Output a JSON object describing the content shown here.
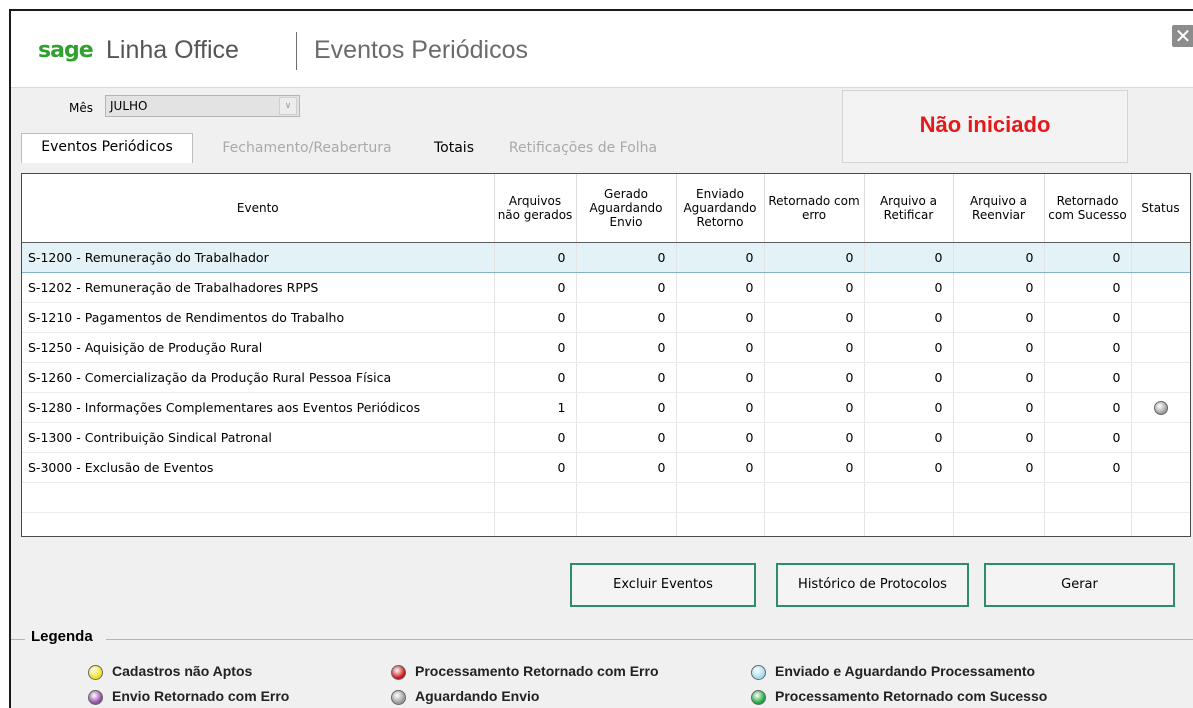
{
  "header": {
    "brand": "sage",
    "product": "Linha Office",
    "module": "Eventos Periódicos",
    "close_icon": "close-icon"
  },
  "filter": {
    "month_label": "Mês",
    "month_value": "JULHO"
  },
  "status": {
    "text": "Não iniciado",
    "color": "#e41a1a"
  },
  "tabs": [
    {
      "label": "Eventos Periódicos",
      "state": "active"
    },
    {
      "label": "Fechamento/Reabertura",
      "state": "disabled"
    },
    {
      "label": "Totais",
      "state": "enabled"
    },
    {
      "label": "Retificações de Folha",
      "state": "disabled"
    }
  ],
  "grid": {
    "columns": [
      "Evento",
      "Arquivos não gerados",
      "Gerado Aguardando Envio",
      "Enviado Aguardando Retorno",
      "Retornado com erro",
      "Arquivo a Retificar",
      "Arquivo a Reenviar",
      "Retornado com Sucesso",
      "Status"
    ],
    "rows": [
      {
        "evento": "S-1200 - Remuneração do Trabalhador",
        "vals": [
          "0",
          "0",
          "0",
          "0",
          "0",
          "0",
          "0"
        ],
        "status": ""
      },
      {
        "evento": "S-1202 - Remuneração de Trabalhadores RPPS",
        "vals": [
          "0",
          "0",
          "0",
          "0",
          "0",
          "0",
          "0"
        ],
        "status": ""
      },
      {
        "evento": "S-1210 - Pagamentos de Rendimentos do Trabalho",
        "vals": [
          "0",
          "0",
          "0",
          "0",
          "0",
          "0",
          "0"
        ],
        "status": ""
      },
      {
        "evento": "S-1250 - Aquisição de Produção Rural",
        "vals": [
          "0",
          "0",
          "0",
          "0",
          "0",
          "0",
          "0"
        ],
        "status": ""
      },
      {
        "evento": "S-1260 - Comercialização da Produção Rural Pessoa Física",
        "vals": [
          "0",
          "0",
          "0",
          "0",
          "0",
          "0",
          "0"
        ],
        "status": ""
      },
      {
        "evento": "S-1280 - Informações Complementares aos Eventos Periódicos",
        "vals": [
          "1",
          "0",
          "0",
          "0",
          "0",
          "0",
          "0"
        ],
        "status": "grey"
      },
      {
        "evento": "S-1300 - Contribuição Sindical Patronal",
        "vals": [
          "0",
          "0",
          "0",
          "0",
          "0",
          "0",
          "0"
        ],
        "status": ""
      },
      {
        "evento": "S-3000 - Exclusão de Eventos",
        "vals": [
          "0",
          "0",
          "0",
          "0",
          "0",
          "0",
          "0"
        ],
        "status": ""
      }
    ],
    "selected_row": 0
  },
  "buttons": {
    "excluir": "Excluir Eventos",
    "historico": "Histórico de Protocolos",
    "gerar": "Gerar"
  },
  "legend": {
    "title": "Legenda",
    "items": [
      {
        "label": "Cadastros não Aptos",
        "color": "#f2e21a"
      },
      {
        "label": "Processamento Retornado com Erro",
        "color": "#c8141a"
      },
      {
        "label": "Enviado e Aguardando Processamento",
        "color": "#a6dcec"
      },
      {
        "label": "Envio Retornado com Erro",
        "color": "#8e4aa3"
      },
      {
        "label": "Aguardando Envio",
        "color": "#9a9a9a"
      },
      {
        "label": "Processamento Retornado com Sucesso",
        "color": "#1aa83a"
      }
    ]
  }
}
